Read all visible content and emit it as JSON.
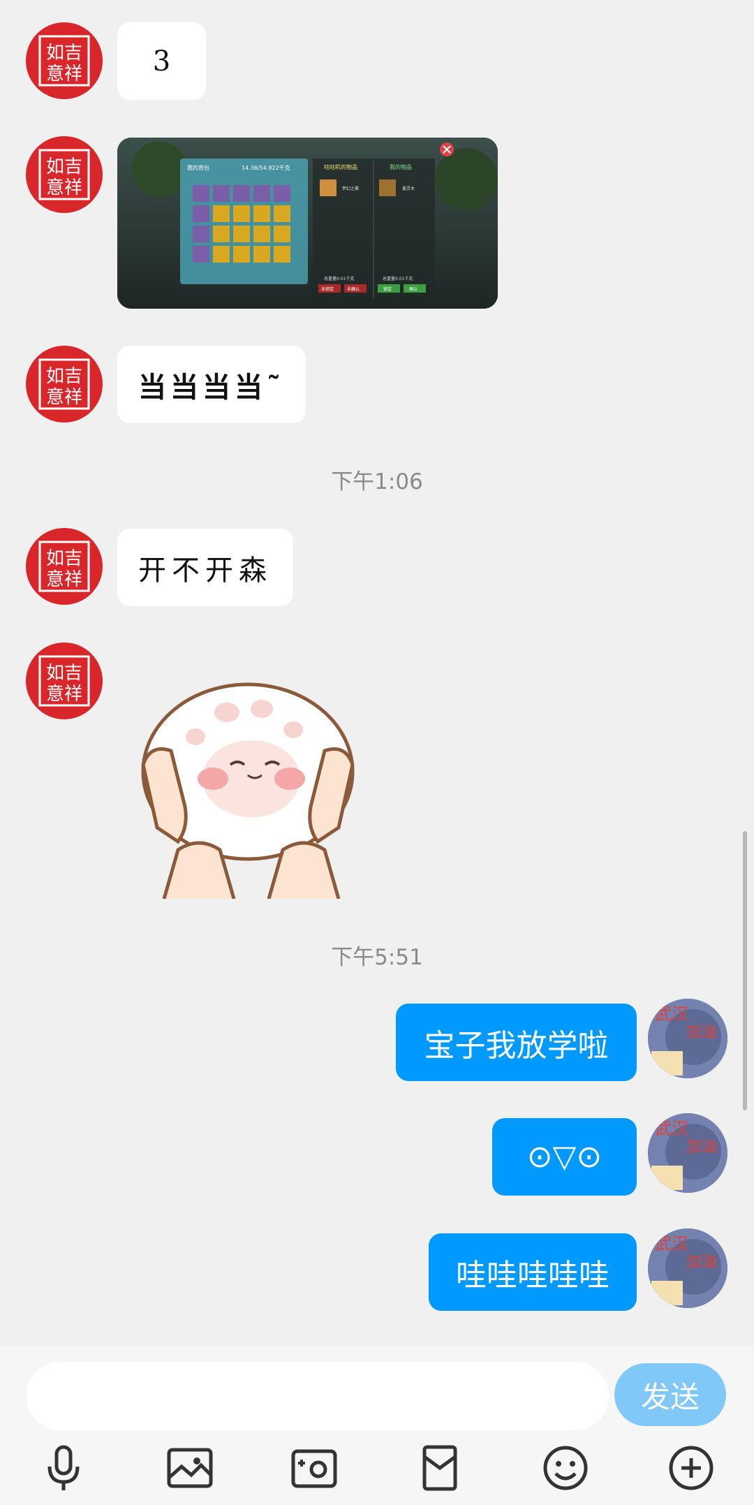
{
  "messages": {
    "m1": "3",
    "m3": "当当当当˜",
    "ts1": "下午1:06",
    "m4": "开不开森",
    "ts2": "下午5:51",
    "me1": "宝子我放学啦",
    "me2": "⊙▽⊙",
    "me3": "哇哇哇哇哇"
  },
  "avatar_left_text": "吉如祥意",
  "avatar_right_text": "武汉加油",
  "game_screenshot": {
    "left_panel_title": "我的背包",
    "left_panel_value": "14.36/54.822千克",
    "mid_title": "咕咕叽的物品",
    "right_title": "我的物品",
    "item_a": "梦幻之翼",
    "item_b": "墨灵木",
    "weight_a": "总重量0.01千克",
    "weight_b": "总重量0.01千克",
    "btn1": "未锁定",
    "btn2": "未确认",
    "btn3": "锁定",
    "btn4": "确认"
  },
  "input": {
    "placeholder": ""
  },
  "send_label": "发送",
  "colors": {
    "sent_bubble": "#0099ff",
    "send_button": "#80c8f8",
    "avatar_red": "#d8262a"
  },
  "toolbar_icons": [
    "microphone-icon",
    "image-icon",
    "camera-icon",
    "red-packet-icon",
    "emoji-icon",
    "plus-icon"
  ]
}
